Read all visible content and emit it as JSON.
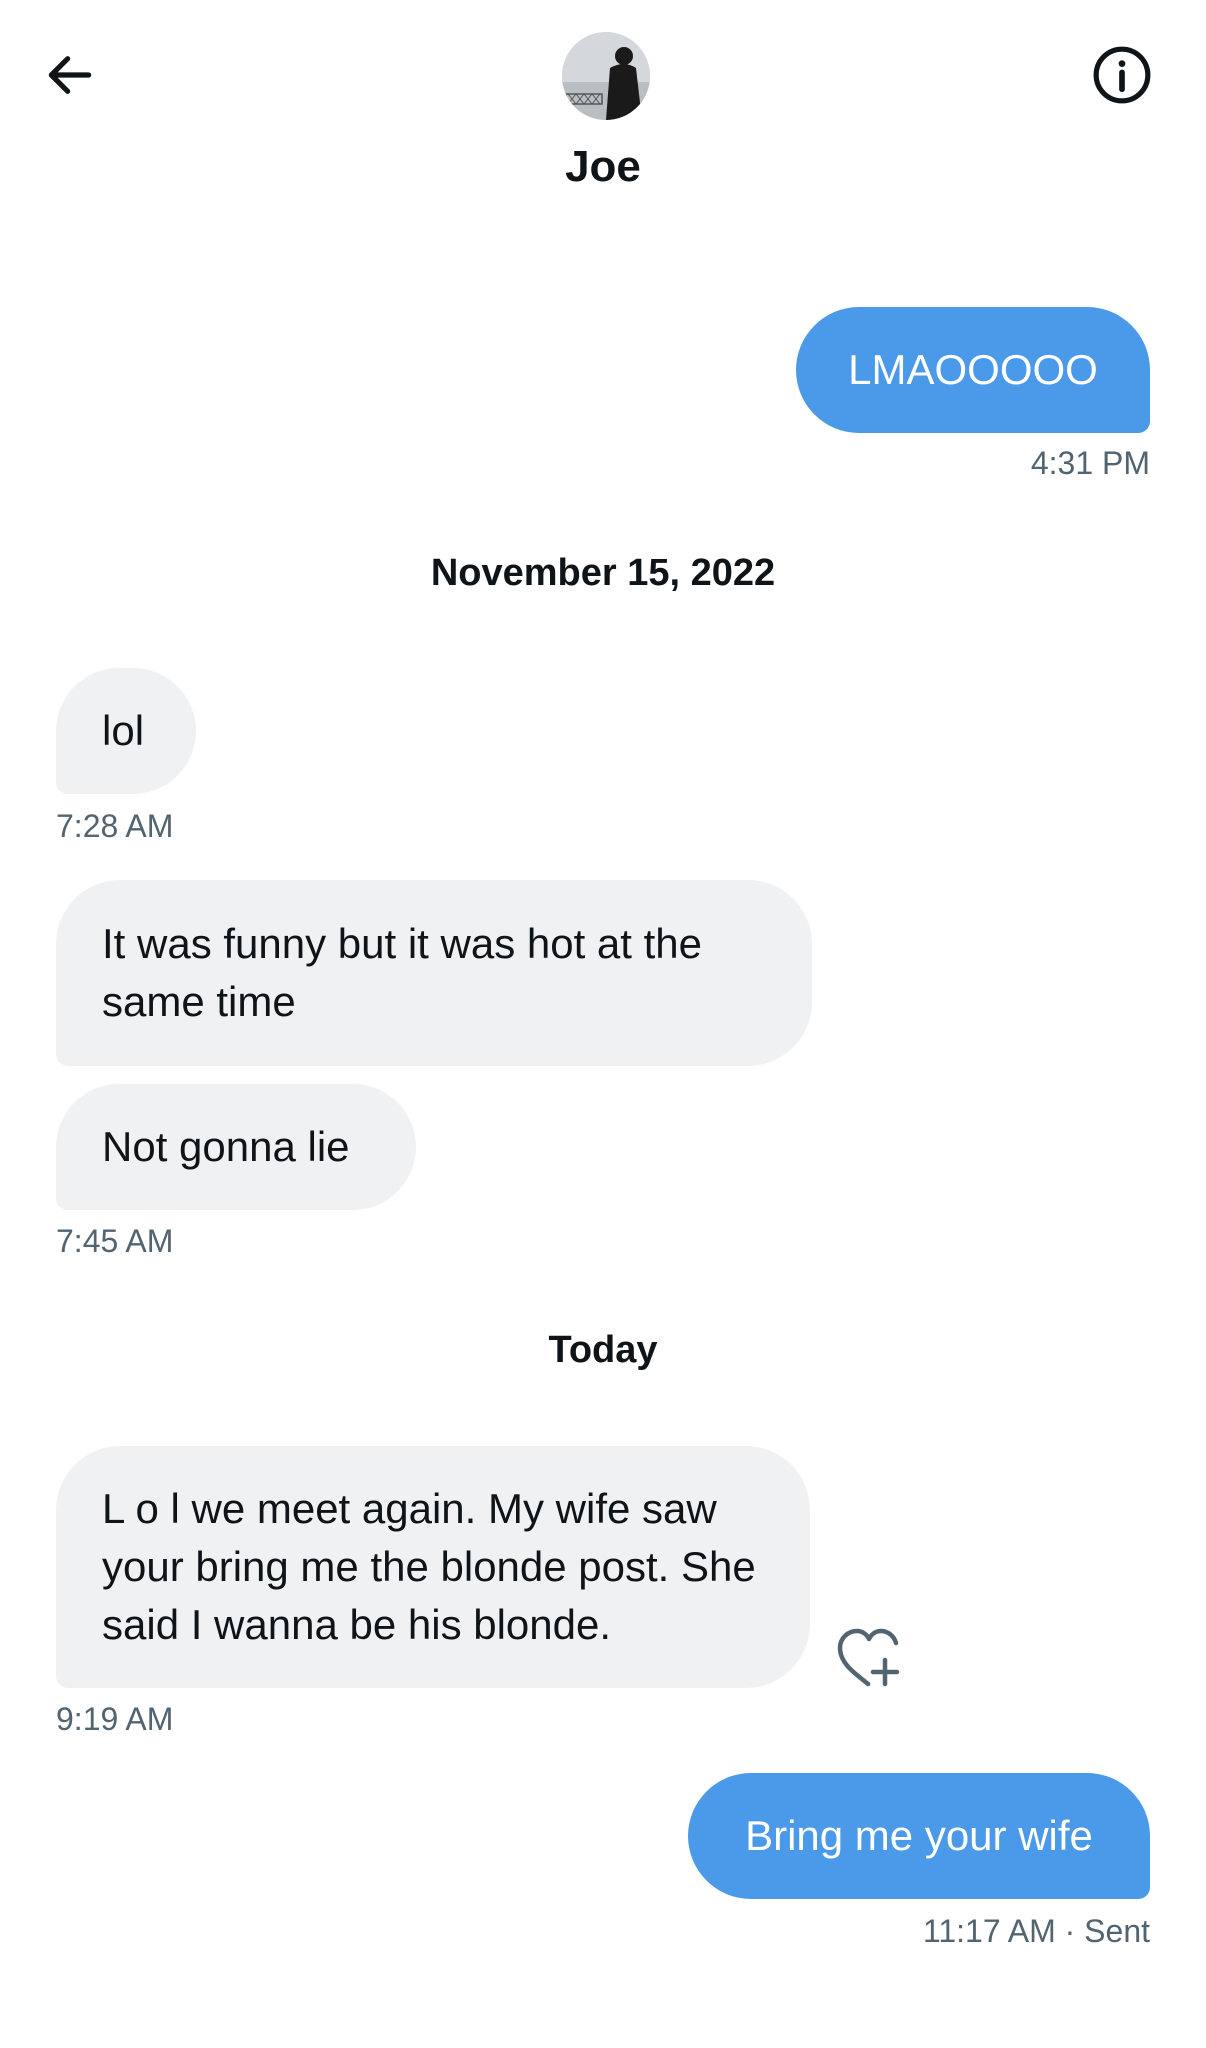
{
  "header": {
    "contact_name": "Joe",
    "back_icon": "arrow-left-icon",
    "info_icon": "info-circle-icon"
  },
  "messages": [
    {
      "direction": "sent",
      "text": "LMAOOOOO",
      "time": "4:31 PM"
    },
    {
      "separator": "November 15, 2022"
    },
    {
      "direction": "received",
      "text": "lol",
      "time": "7:28 AM"
    },
    {
      "direction": "received",
      "text": "It was funny but it was hot at the same time"
    },
    {
      "direction": "received",
      "text": "Not gonna lie",
      "time": "7:45 AM"
    },
    {
      "separator": "Today"
    },
    {
      "direction": "received",
      "text": "L o l we meet again. My wife saw your bring me the blonde post. She said I wanna be his blonde.",
      "time": "9:19 AM"
    },
    {
      "direction": "sent",
      "text": "Bring me your wife",
      "time": "11:17 AM",
      "status": "Sent"
    }
  ],
  "colors": {
    "sent_bubble": "#4a9ae9",
    "received_bubble": "#eff1f3",
    "meta_text": "#536471"
  }
}
